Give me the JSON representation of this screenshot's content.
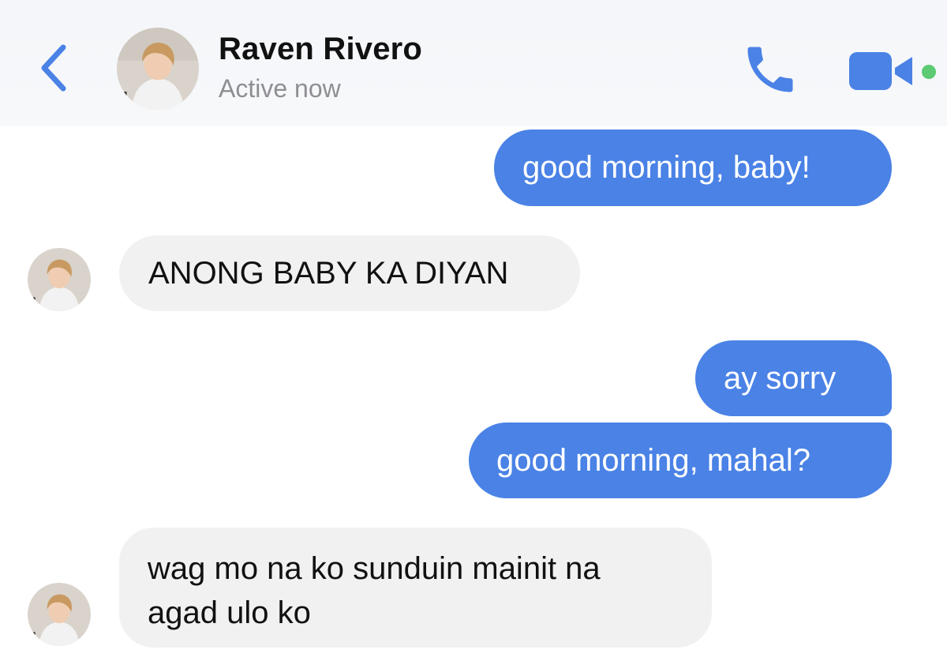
{
  "header": {
    "contact_name": "Raven Rivero",
    "status": "Active now",
    "active_indicator_color": "#5ccb74",
    "accent_color": "#4a82e6",
    "icons": {
      "back": "chevron-left-icon",
      "call": "phone-icon",
      "video": "video-camera-icon"
    }
  },
  "messages": [
    {
      "direction": "outgoing",
      "text": "good morning, baby!"
    },
    {
      "direction": "incoming",
      "text": "ANONG BABY KA DIYAN"
    },
    {
      "direction": "outgoing",
      "text": "ay sorry"
    },
    {
      "direction": "outgoing",
      "text": "good morning, mahal?"
    },
    {
      "direction": "incoming",
      "lines": [
        "wag mo na ko sunduin mainit na",
        "agad ulo ko"
      ]
    }
  ]
}
